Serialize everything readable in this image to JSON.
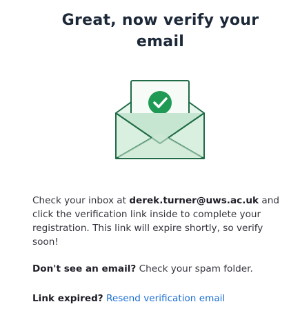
{
  "header": {
    "title": "Great, now verify your email"
  },
  "illustration": {
    "icon": "envelope-check-icon",
    "colors": {
      "stroke": "#1e6b45",
      "fill_light": "#dff1e5",
      "fill_mid": "#c7e6d1",
      "check_circle": "#1f9a55"
    }
  },
  "message": {
    "intro": "Check your inbox at",
    "email": "derek.turner@uws.ac.uk",
    "rest": "and click the verification link inside to complete your registration. This link will expire shortly, so verify soon!"
  },
  "spam": {
    "bold": "Don't see an email?",
    "text": "Check your spam folder."
  },
  "expired": {
    "bold": "Link expired?",
    "link": "Resend verification email",
    "link_color": "#1a6fd6"
  }
}
